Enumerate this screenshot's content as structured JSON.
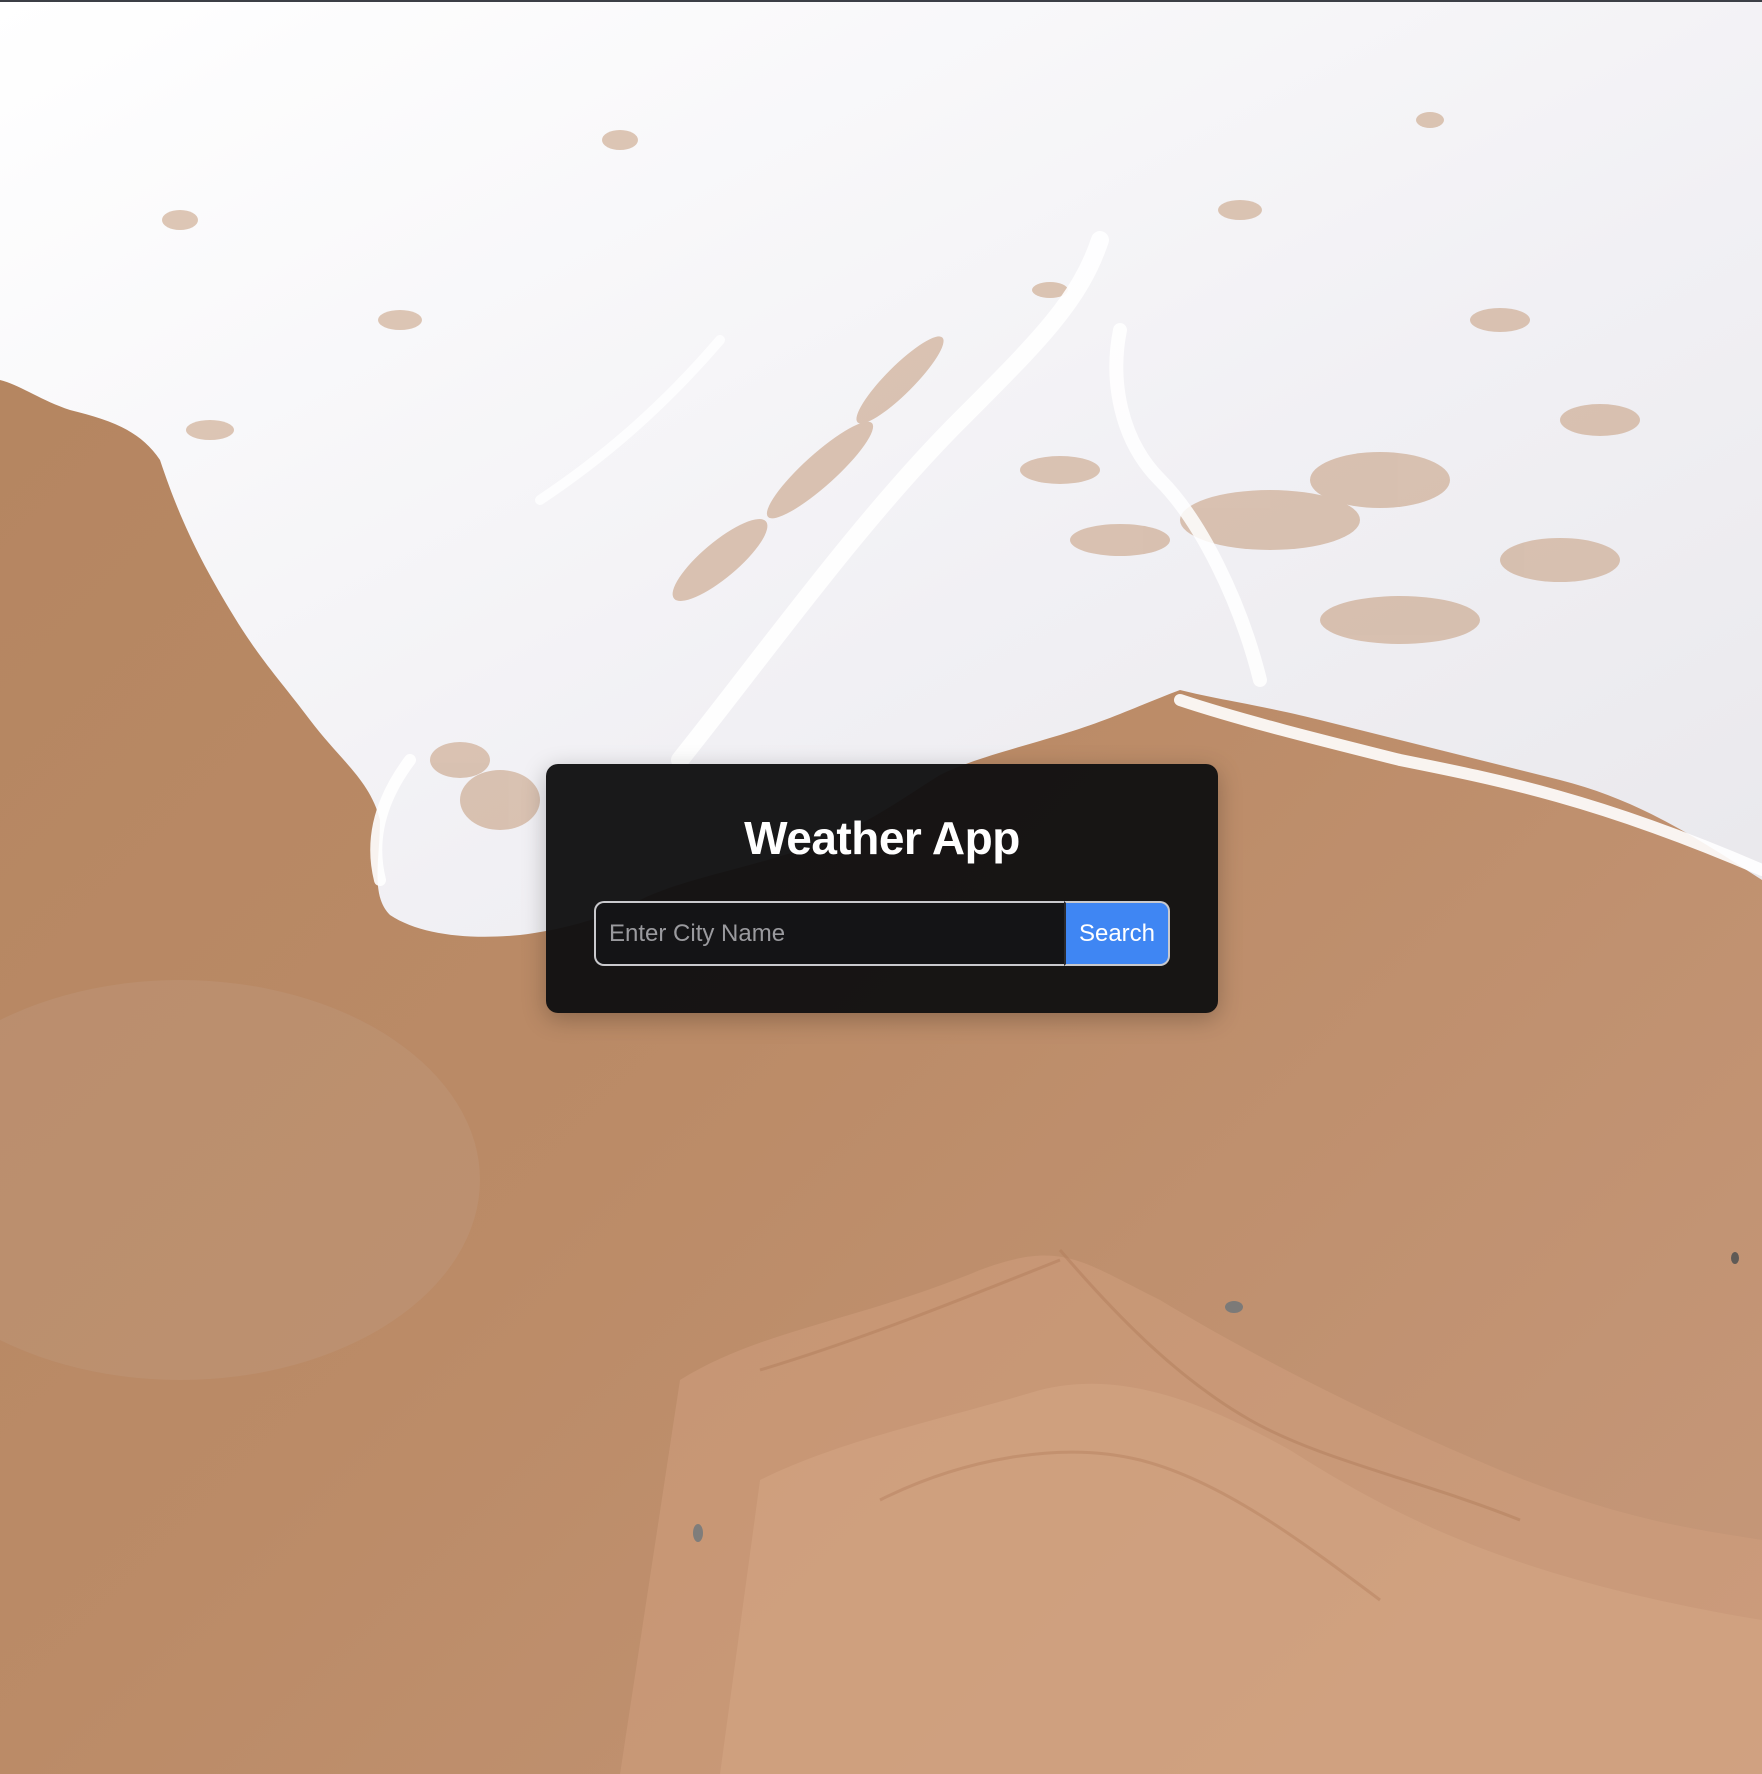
{
  "app": {
    "title": "Weather App"
  },
  "search": {
    "placeholder": "Enter City Name",
    "value": "",
    "button_label": "Search"
  },
  "colors": {
    "card_background": "#101011",
    "search_button": "#3f86f3",
    "sand": "#b98a68",
    "foam": "#f4f3f6"
  }
}
